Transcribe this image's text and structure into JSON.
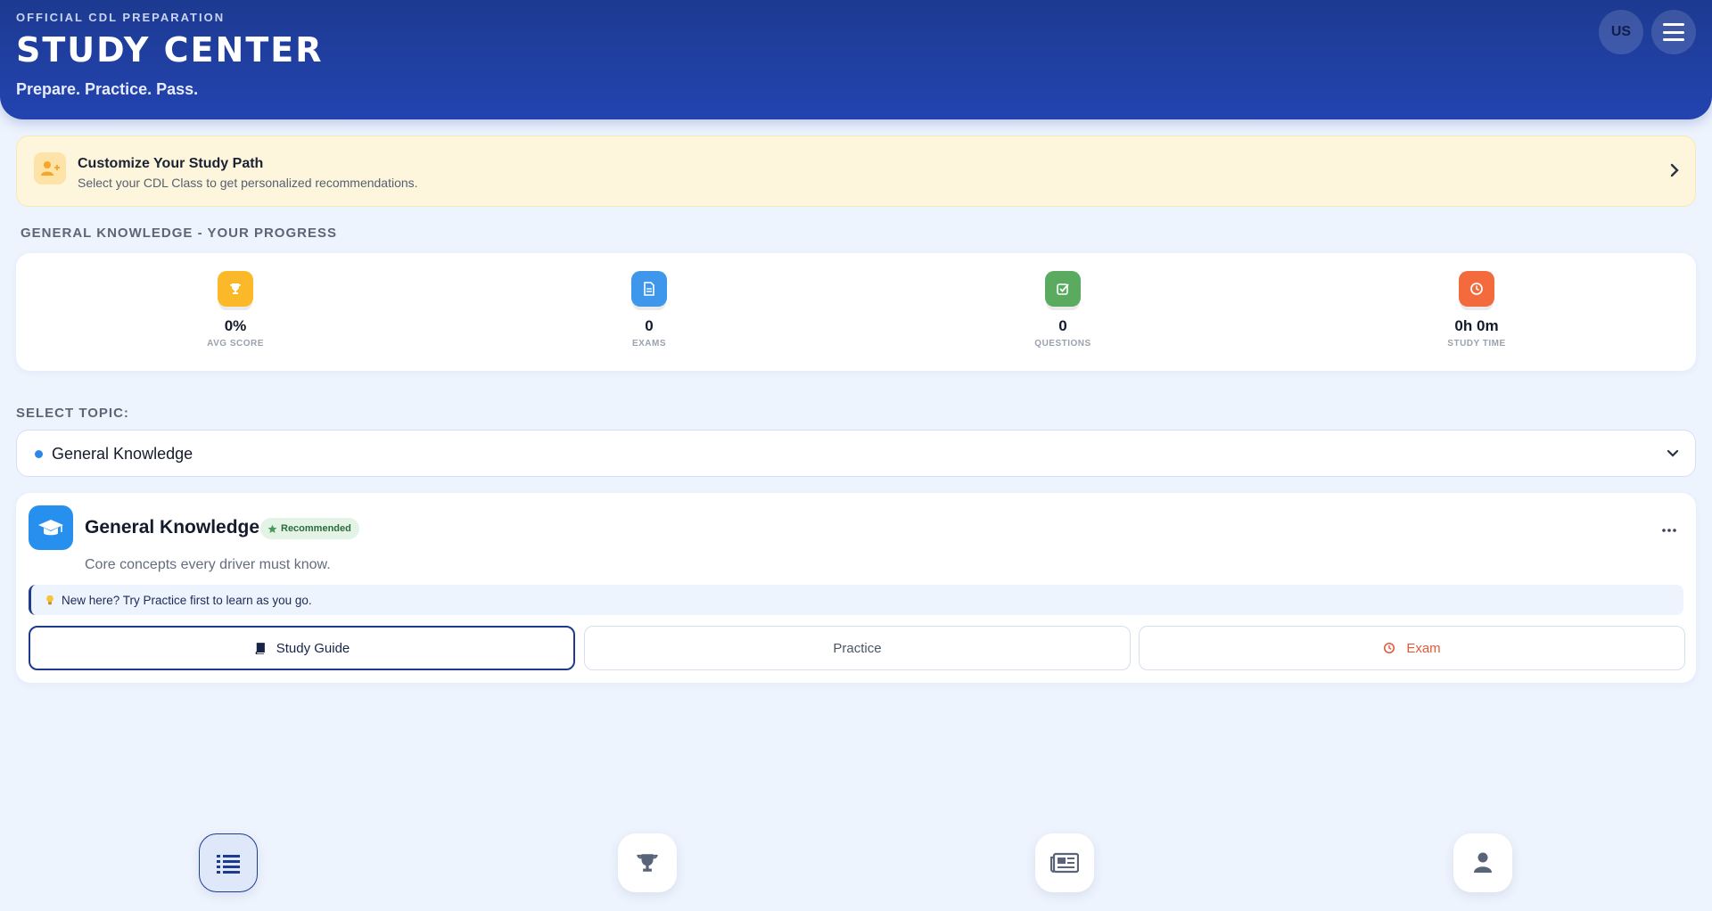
{
  "header": {
    "eyebrow": "OFFICIAL CDL PREPARATION",
    "title": "STUDY CENTER",
    "tagline": "Prepare. Practice. Pass.",
    "region_button": "US",
    "menu_icon": "hamburger-menu-icon"
  },
  "customize": {
    "icon": "user-plus-icon",
    "title": "Customize Your Study Path",
    "subtitle": "Select your CDL Class to get personalized recommendations."
  },
  "progress": {
    "section_label": "GENERAL KNOWLEDGE - YOUR PROGRESS",
    "stats": [
      {
        "icon": "trophy-icon",
        "value": "0%",
        "label": "AVG SCORE",
        "color": "#fbb92a"
      },
      {
        "icon": "document-icon",
        "value": "0",
        "label": "EXAMS",
        "color": "#3e97eb"
      },
      {
        "icon": "checkbox-icon",
        "value": "0",
        "label": "QUESTIONS",
        "color": "#5aaa5f"
      },
      {
        "icon": "clock-icon",
        "value": "0h 0m",
        "label": "STUDY TIME",
        "color": "#f36a3d"
      }
    ]
  },
  "topic_select": {
    "label": "SELECT TOPIC:",
    "selected": "General Knowledge"
  },
  "topic_card": {
    "icon": "graduation-cap-icon",
    "title": "General Knowledge",
    "badge": "Recommended",
    "description": "Core concepts every driver must know.",
    "tip": "New here? Try Practice first to learn as you go.",
    "buttons": {
      "study_guide": "Study Guide",
      "practice": "Practice",
      "exam": "Exam"
    }
  },
  "bottom_nav": [
    {
      "icon": "list-icon",
      "active": true
    },
    {
      "icon": "trophy-icon",
      "active": false
    },
    {
      "icon": "newspaper-icon",
      "active": false
    },
    {
      "icon": "user-icon",
      "active": false
    }
  ],
  "colors": {
    "header": "#1d3a91",
    "background": "#eef4fe",
    "accent_blue": "#2790ee",
    "exam_red": "#e35a3b",
    "customize_bg": "#fef6dc"
  }
}
